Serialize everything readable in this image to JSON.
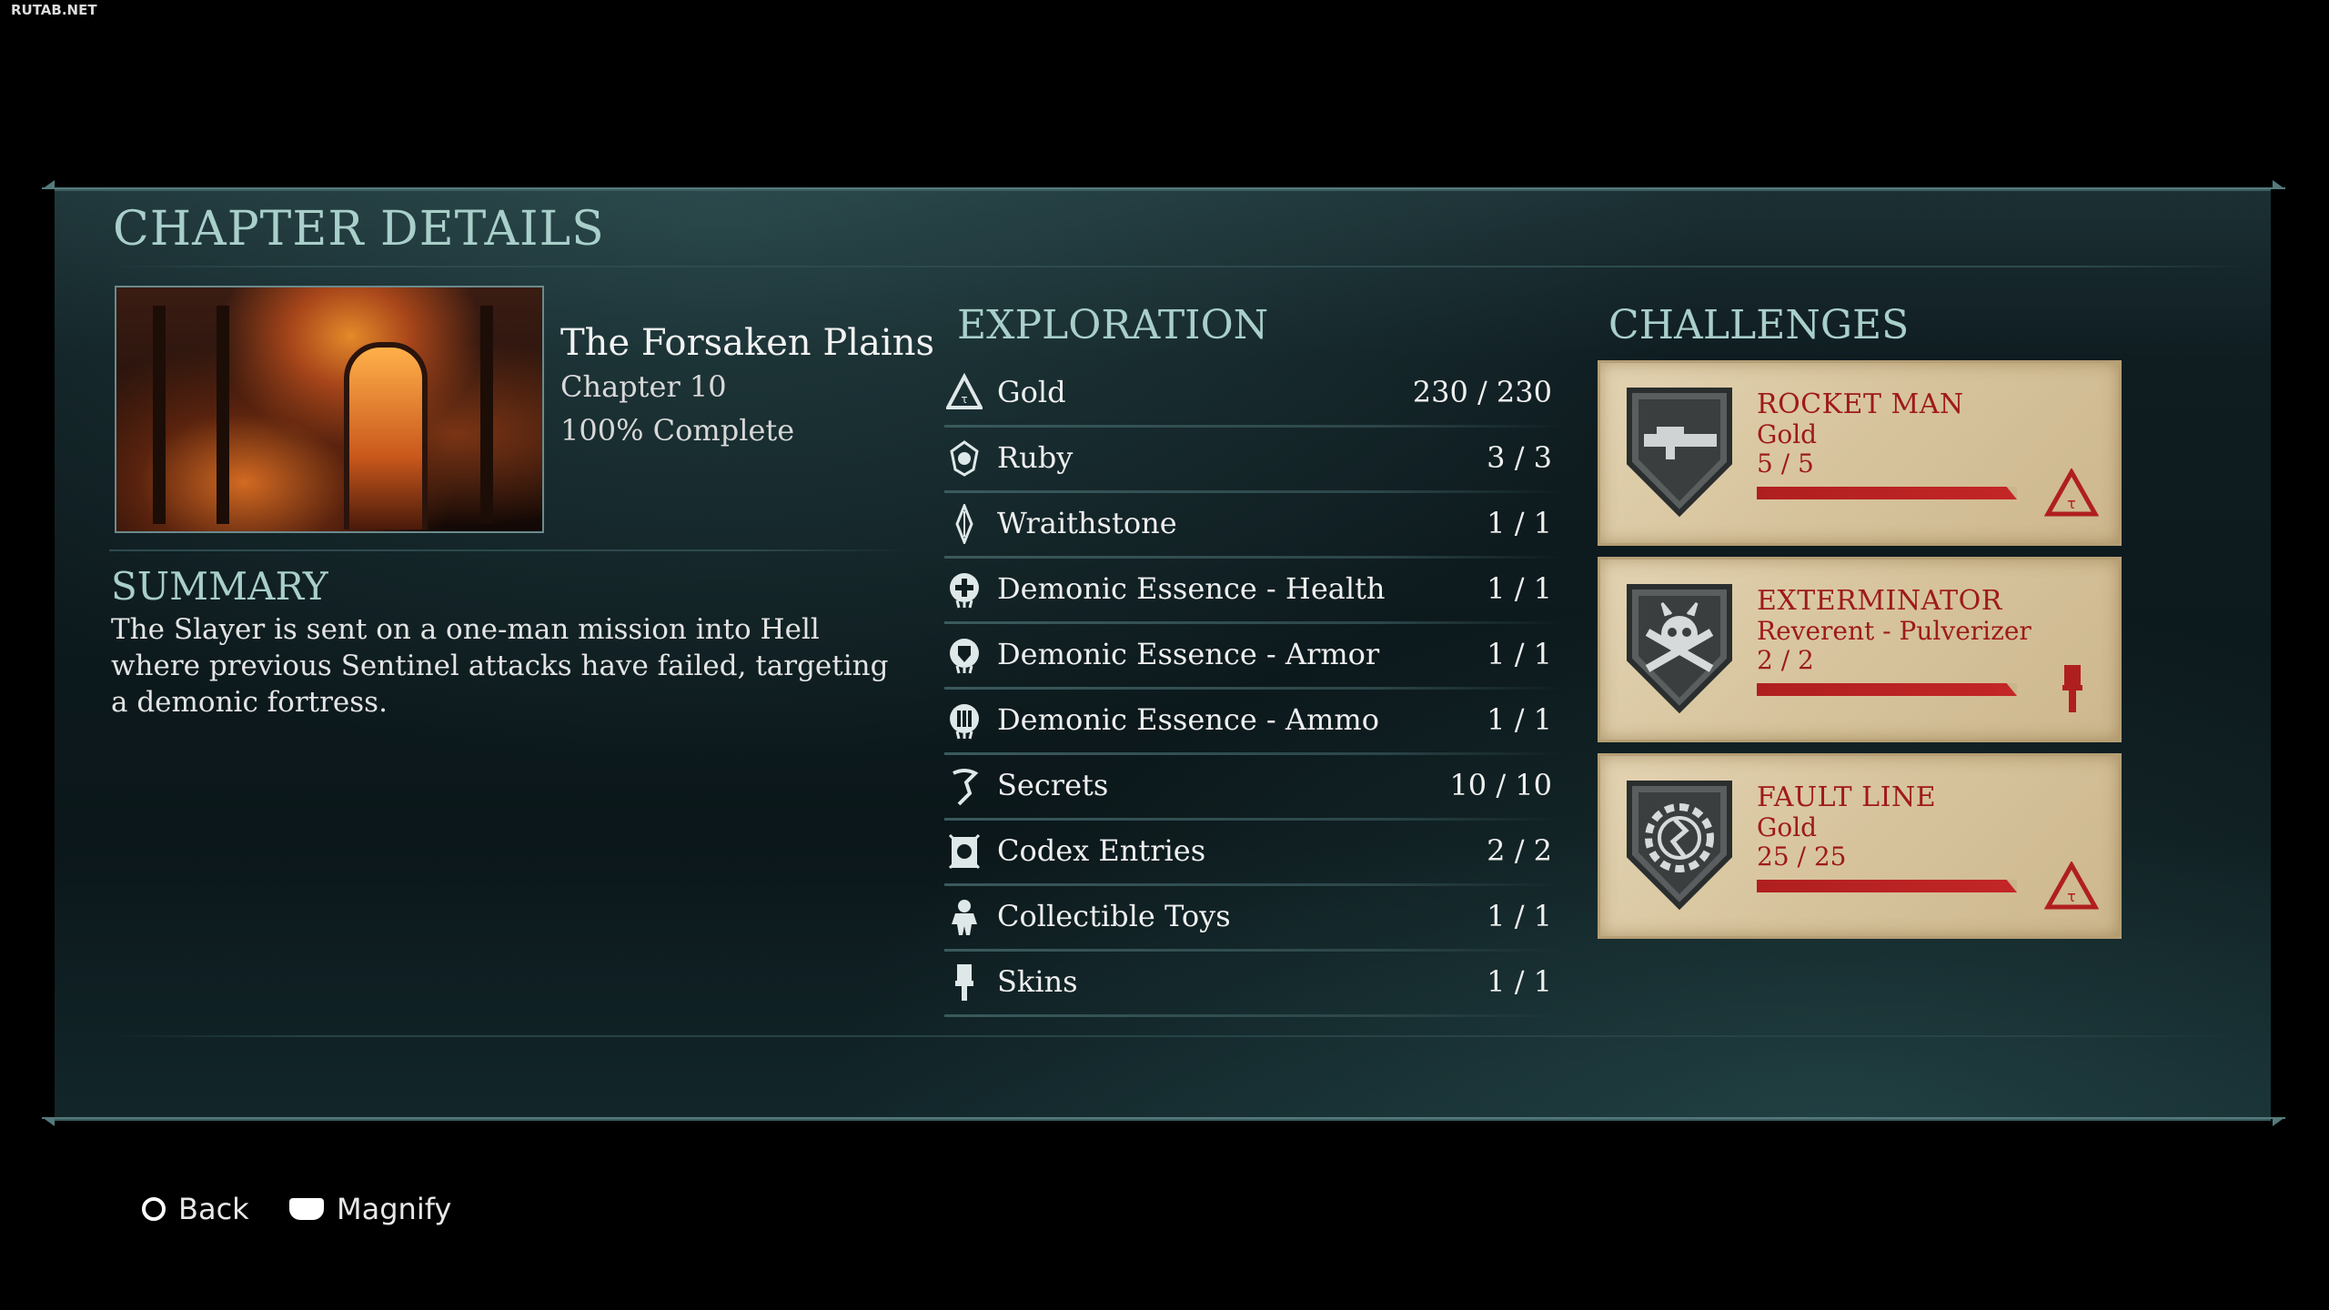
{
  "watermark": "RUTAB.NET",
  "screen_title": "CHAPTER DETAILS",
  "chapter": {
    "name": "The Forsaken Plains",
    "number": "Chapter 10",
    "completion": "100% Complete"
  },
  "summary": {
    "heading": "SUMMARY",
    "text": "The Slayer is sent on a one-man mission into Hell where previous Sentinel attacks have failed, targeting a demonic fortress."
  },
  "exploration": {
    "heading": "EXPLORATION",
    "items": [
      {
        "icon": "gold-icon",
        "label": "Gold",
        "value": "230 / 230"
      },
      {
        "icon": "ruby-icon",
        "label": "Ruby",
        "value": "3 / 3"
      },
      {
        "icon": "wraithstone-icon",
        "label": "Wraithstone",
        "value": "1 / 1"
      },
      {
        "icon": "health-essence-icon",
        "label": "Demonic Essence - Health",
        "value": "1 / 1"
      },
      {
        "icon": "armor-essence-icon",
        "label": "Demonic Essence - Armor",
        "value": "1 / 1"
      },
      {
        "icon": "ammo-essence-icon",
        "label": "Demonic Essence - Ammo",
        "value": "1 / 1"
      },
      {
        "icon": "secrets-icon",
        "label": "Secrets",
        "value": "10 / 10"
      },
      {
        "icon": "codex-icon",
        "label": "Codex Entries",
        "value": "2 / 2"
      },
      {
        "icon": "toy-icon",
        "label": "Collectible Toys",
        "value": "1 / 1"
      },
      {
        "icon": "skin-brush-icon",
        "label": "Skins",
        "value": "1 / 1"
      }
    ]
  },
  "challenges": {
    "heading": "CHALLENGES",
    "items": [
      {
        "title": "ROCKET MAN",
        "reward": "Gold",
        "progress": "5 / 5",
        "progress_fraction": 1.0,
        "badge_icon": "rocket-launcher-icon",
        "reward_icon": "gold-icon"
      },
      {
        "title": "EXTERMINATOR",
        "reward": "Reverent - Pulverizer",
        "progress": "2 / 2",
        "progress_fraction": 1.0,
        "badge_icon": "skull-crossbones-icon",
        "reward_icon": "paint-brush-icon"
      },
      {
        "title": "FAULT LINE",
        "reward": "Gold",
        "progress": "25 / 25",
        "progress_fraction": 1.0,
        "badge_icon": "gear-emblem-icon",
        "reward_icon": "gold-icon"
      }
    ]
  },
  "prompts": {
    "back": "Back",
    "magnify": "Magnify"
  },
  "colors": {
    "accent_teal": "#a9cfca",
    "challenge_red": "#9e1a1a",
    "parchment": "#d6c39c"
  }
}
